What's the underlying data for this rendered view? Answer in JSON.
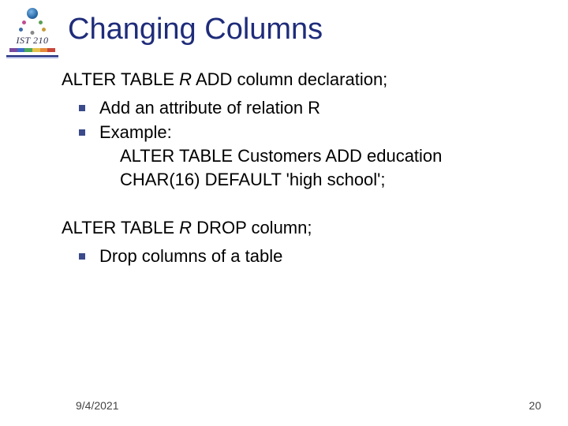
{
  "logo": {
    "label": "IST 210"
  },
  "title": "Changing Columns",
  "section1": {
    "line1_a": "ALTER TABLE ",
    "line1_b": "R",
    "line1_c": "  ADD column declaration;",
    "bullets": [
      {
        "text": "Add an attribute of relation R"
      },
      {
        "text": "Example:",
        "sub": [
          "ALTER TABLE Customers ADD education",
          "CHAR(16) DEFAULT 'high school';"
        ]
      }
    ]
  },
  "section2": {
    "line1_a": "ALTER TABLE ",
    "line1_b": "R",
    "line1_c": "  DROP column;",
    "bullets": [
      {
        "text": "Drop columns of a table"
      }
    ]
  },
  "footer": {
    "date": "9/4/2021",
    "page": "20"
  }
}
